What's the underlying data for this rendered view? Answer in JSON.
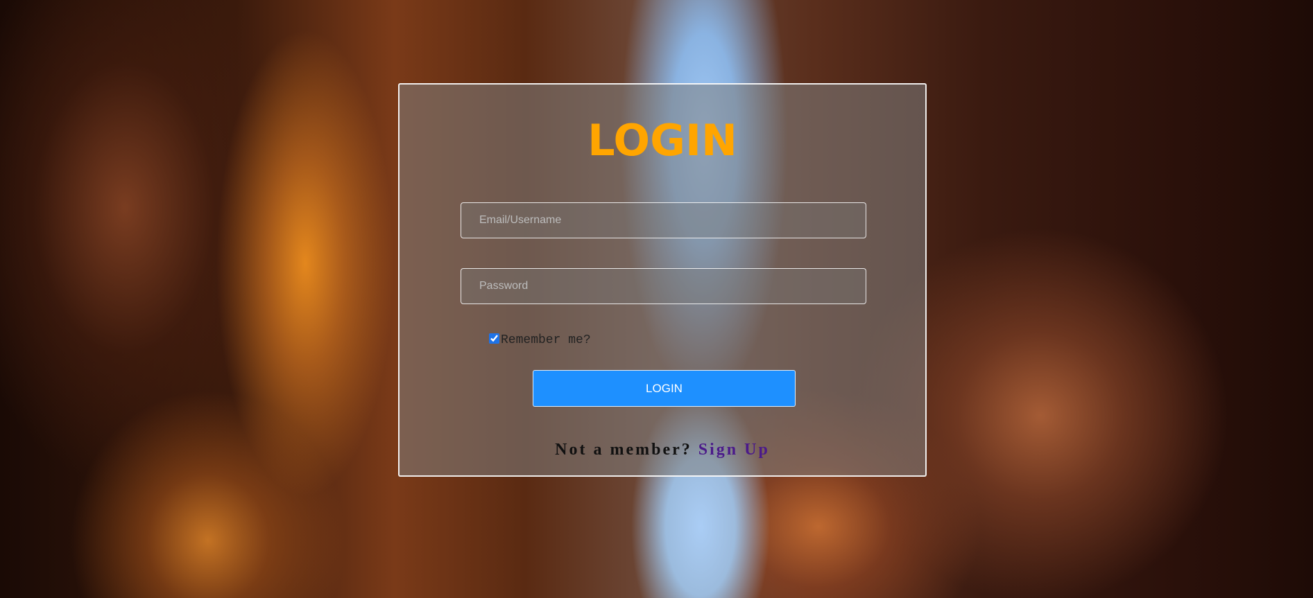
{
  "login": {
    "title": "LOGIN",
    "email": {
      "value": "",
      "placeholder": "Email/Username"
    },
    "password": {
      "value": "",
      "placeholder": "Password"
    },
    "remember": {
      "label": "Remember me?",
      "checked": true
    },
    "submit_label": "LOGIN",
    "signup_prompt": "Not a member?",
    "signup_link": "Sign Up"
  },
  "colors": {
    "title": "#ffa500",
    "button": "#1e90ff",
    "link": "#4b1a8a"
  }
}
